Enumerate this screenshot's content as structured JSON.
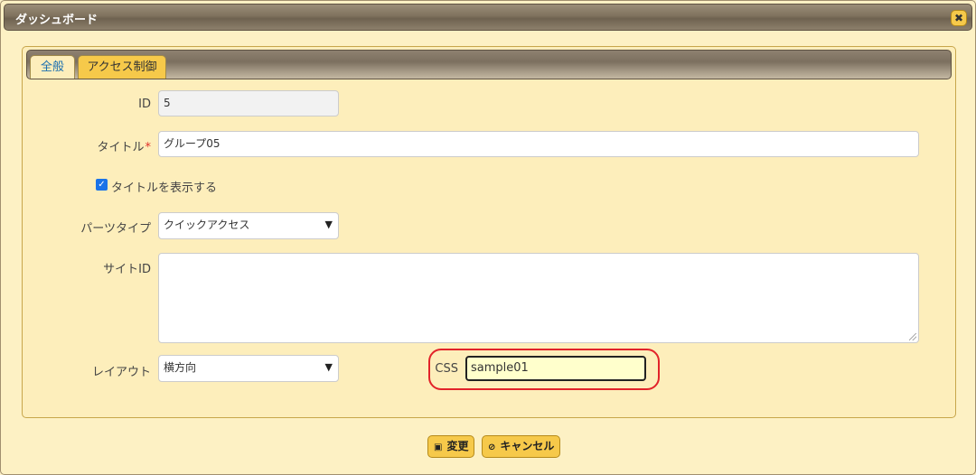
{
  "dialog": {
    "title": "ダッシュボード",
    "close_icon": "✖"
  },
  "tabs": [
    {
      "label": "全般",
      "active": true
    },
    {
      "label": "アクセス制御",
      "active": false
    }
  ],
  "form": {
    "id": {
      "label": "ID",
      "value": "5"
    },
    "title": {
      "label": "タイトル",
      "required_mark": "*",
      "value": "グループ05"
    },
    "show_title": {
      "label": "タイトルを表示する",
      "checked": true
    },
    "parts_type": {
      "label": "パーツタイプ",
      "value": "クイックアクセス"
    },
    "site_id": {
      "label": "サイトID",
      "value": ""
    },
    "layout": {
      "label": "レイアウト",
      "value": "横方向"
    },
    "css": {
      "label": "CSS",
      "value": "sample01"
    }
  },
  "buttons": {
    "update": {
      "label": "変更",
      "icon": "save-icon"
    },
    "cancel": {
      "label": "キャンセル",
      "icon": "cancel-icon"
    }
  },
  "colors": {
    "accent": "#f6c94a",
    "highlight": "#e2232a",
    "tab_active_text": "#1a6fb0"
  }
}
